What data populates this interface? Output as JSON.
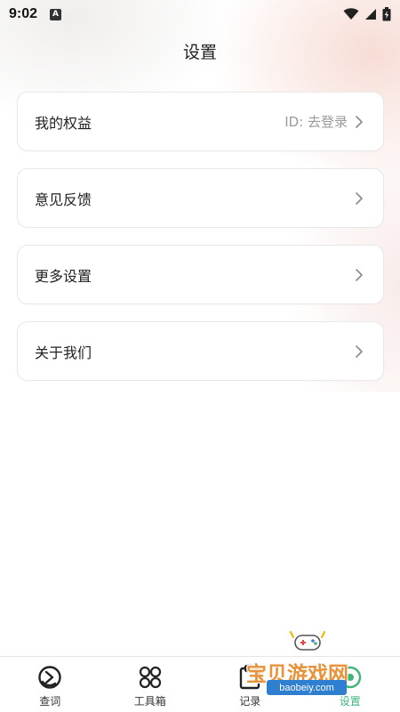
{
  "status_bar": {
    "time": "9:02",
    "notification_glyph": "A"
  },
  "header": {
    "title": "设置"
  },
  "menu": {
    "items": [
      {
        "label": "我的权益",
        "value": "ID: 去登录"
      },
      {
        "label": "意见反馈",
        "value": ""
      },
      {
        "label": "更多设置",
        "value": ""
      },
      {
        "label": "关于我们",
        "value": ""
      }
    ]
  },
  "bottom_nav": {
    "items": [
      {
        "label": "查词",
        "icon": "lookup-icon",
        "active": false
      },
      {
        "label": "工具箱",
        "icon": "toolbox-icon",
        "active": false
      },
      {
        "label": "记录",
        "icon": "clipboard-icon",
        "active": false
      },
      {
        "label": "设置",
        "icon": "settings-icon",
        "active": true
      }
    ],
    "active_color": "#3fb57a"
  },
  "watermark": {
    "brand": "宝贝游戏网",
    "url": "baobeiy.com"
  }
}
